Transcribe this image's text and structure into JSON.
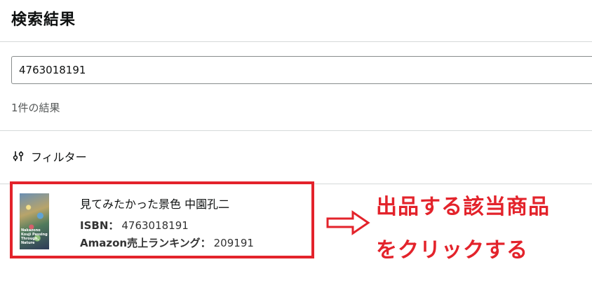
{
  "header": {
    "title": "検索結果"
  },
  "search": {
    "value": "4763018191"
  },
  "results": {
    "count_text": "1件の結果"
  },
  "filter": {
    "label": "フィルター",
    "icon": "sliders-icon"
  },
  "item": {
    "title": "見てみたかった景色 中園孔二",
    "isbn_label": "ISBN：",
    "isbn_value": "4763018191",
    "rank_label": "Amazon売上ランキング：",
    "rank_value": "209191",
    "cover_text": "Nakazono Kouji Passing Through, Nature"
  },
  "annotation": {
    "line1": "出品する該当商品",
    "line2": "をクリックする",
    "color": "#e3232b"
  }
}
